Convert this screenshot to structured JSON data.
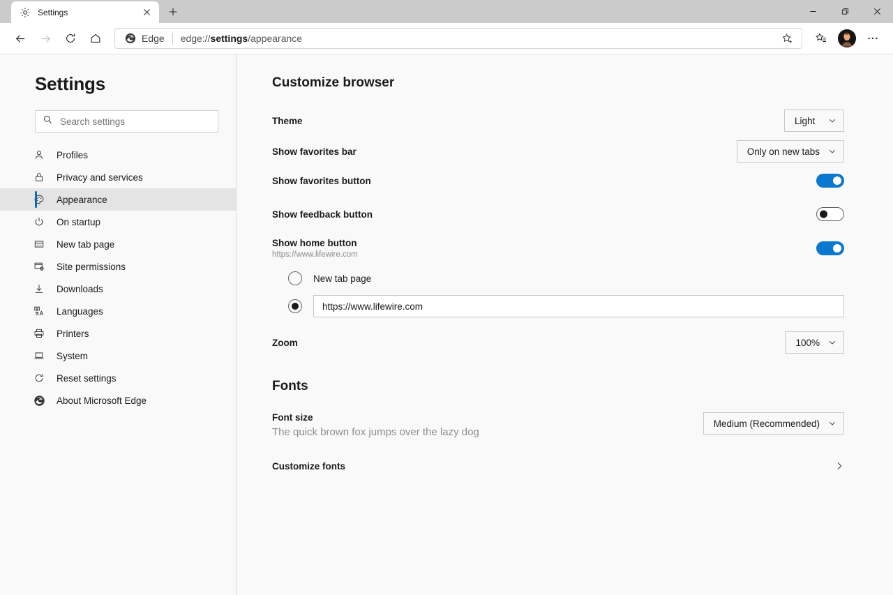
{
  "window": {
    "tab": {
      "title": "Settings",
      "favicon": "gear-icon"
    },
    "new_tab_label": "+",
    "controls": {
      "minimize": "—",
      "restore": "❐",
      "close": "✕"
    }
  },
  "toolbar": {
    "back": "back-arrow-icon",
    "forward": "forward-arrow-icon",
    "refresh": "refresh-icon",
    "home": "home-icon",
    "edge_label": "Edge",
    "url_prefix": "edge://",
    "url_bold": "settings",
    "url_suffix": "/appearance",
    "url_full": "edge://settings/appearance",
    "favorite_icon": "star-add-icon",
    "favorites_list_icon": "favorites-list-icon",
    "avatar_icon": "profile-avatar",
    "more_icon": "ellipsis-icon"
  },
  "sidebar": {
    "title": "Settings",
    "search": {
      "placeholder": "Search settings",
      "value": ""
    },
    "items": [
      {
        "label": "Profiles",
        "icon": "person-icon",
        "active": false
      },
      {
        "label": "Privacy and services",
        "icon": "lock-icon",
        "active": false
      },
      {
        "label": "Appearance",
        "icon": "palette-icon",
        "active": true
      },
      {
        "label": "On startup",
        "icon": "power-icon",
        "active": false
      },
      {
        "label": "New tab page",
        "icon": "new-tab-page-icon",
        "active": false
      },
      {
        "label": "Site permissions",
        "icon": "site-permissions-icon",
        "active": false
      },
      {
        "label": "Downloads",
        "icon": "download-arrow-icon",
        "active": false
      },
      {
        "label": "Languages",
        "icon": "languages-icon",
        "active": false
      },
      {
        "label": "Printers",
        "icon": "printer-icon",
        "active": false
      },
      {
        "label": "System",
        "icon": "laptop-icon",
        "active": false
      },
      {
        "label": "Reset settings",
        "icon": "reset-icon",
        "active": false
      },
      {
        "label": "About Microsoft Edge",
        "icon": "edge-logo-icon",
        "active": false
      }
    ]
  },
  "main": {
    "section_customize": "Customize browser",
    "theme": {
      "label": "Theme",
      "value": "Light"
    },
    "favorites_bar": {
      "label": "Show favorites bar",
      "value": "Only on new tabs"
    },
    "favorites_button": {
      "label": "Show favorites button",
      "state": "on"
    },
    "feedback_button": {
      "label": "Show feedback button",
      "state": "off"
    },
    "home_button": {
      "label": "Show home button",
      "sub": "https://www.lifewire.com",
      "state": "on",
      "option_newtab": "New tab page",
      "option_url_value": "https://www.lifewire.com",
      "selected": "url"
    },
    "zoom": {
      "label": "Zoom",
      "value": "100%"
    },
    "section_fonts": "Fonts",
    "font_size": {
      "label": "Font size",
      "value": "Medium (Recommended)",
      "sample": "The quick brown fox jumps over the lazy dog"
    },
    "customize_fonts": {
      "label": "Customize fonts",
      "chevron": "chevron-right-icon"
    }
  },
  "colors": {
    "accent": "#0b78d0",
    "titlebar": "#cbcbcb",
    "page_bg": "#f9f9f9",
    "selected_row": "#e4e4e4"
  }
}
